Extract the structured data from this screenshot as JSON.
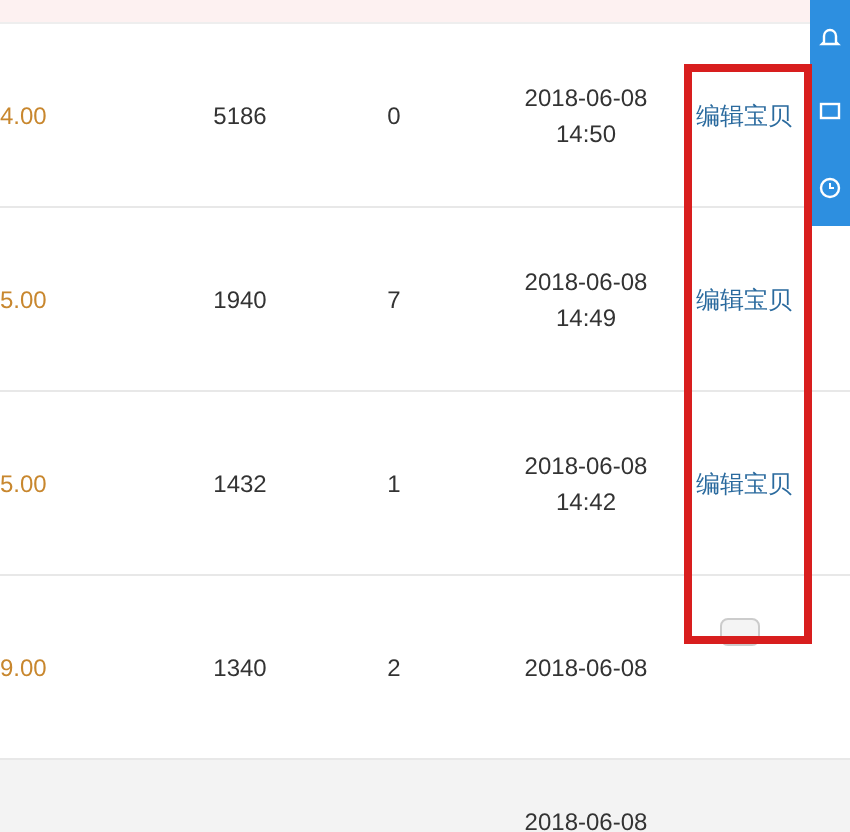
{
  "rows": [
    {
      "price": "4.00",
      "views": "5186",
      "sales": "0",
      "date": "2018-06-08",
      "time": "14:50",
      "action": {
        "kind": "link",
        "label": "编辑宝贝"
      }
    },
    {
      "price": "5.00",
      "views": "1940",
      "sales": "7",
      "date": "2018-06-08",
      "time": "14:49",
      "action": {
        "kind": "link",
        "label": "编辑宝贝"
      }
    },
    {
      "price": "5.00",
      "views": "1432",
      "sales": "1",
      "date": "2018-06-08",
      "time": "14:42",
      "action": {
        "kind": "link",
        "label": "编辑宝贝"
      }
    },
    {
      "price": "9.00",
      "views": "1340",
      "sales": "2",
      "date": "2018-06-08",
      "action": {
        "kind": "button"
      }
    }
  ],
  "last_row": {
    "date": "2018-06-08"
  }
}
